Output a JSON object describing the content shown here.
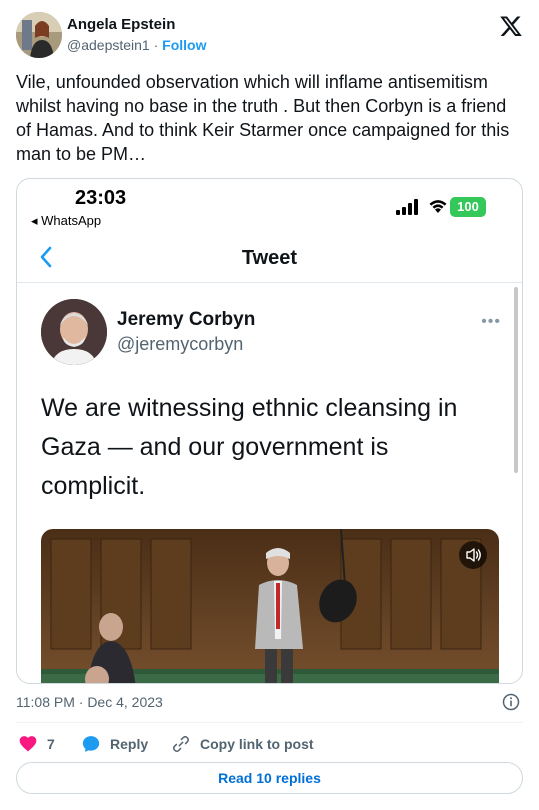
{
  "author": {
    "name": "Angela Epstein",
    "handle": "@adepstein1",
    "separator": "·",
    "follow_label": "Follow"
  },
  "tweet": {
    "text": "Vile, unfounded observation which will inflame antisemitism whilst having no base in the truth . But then Corbyn is a friend of Hamas. And to think Keir Starmer once campaigned for this man to be PM…",
    "timestamp": "11:08 PM · Dec 4, 2023",
    "likes_count": "7",
    "reply_label": "Reply",
    "copy_link_label": "Copy link to post",
    "read_replies_label": "Read 10 replies"
  },
  "media": {
    "status_time": "23:03",
    "status_back_app": "◂ WhatsApp",
    "battery": "100",
    "nav_title": "Tweet",
    "inner_author_name": "Jeremy Corbyn",
    "inner_author_handle": "@jeremycorbyn",
    "inner_more": "•••",
    "inner_text": "We are witnessing ethnic cleansing in Gaza — and our government is complicit."
  },
  "colors": {
    "accent": "#1d9bf0",
    "like": "#f91880",
    "link": "#006fd6",
    "battery": "#34c759"
  },
  "icons": [
    "x-logo-icon",
    "chevron-left-icon",
    "signal-icon",
    "wifi-icon",
    "battery-icon",
    "more-icon",
    "speaker-icon",
    "info-icon",
    "heart-icon",
    "reply-bubble-icon",
    "link-icon"
  ]
}
